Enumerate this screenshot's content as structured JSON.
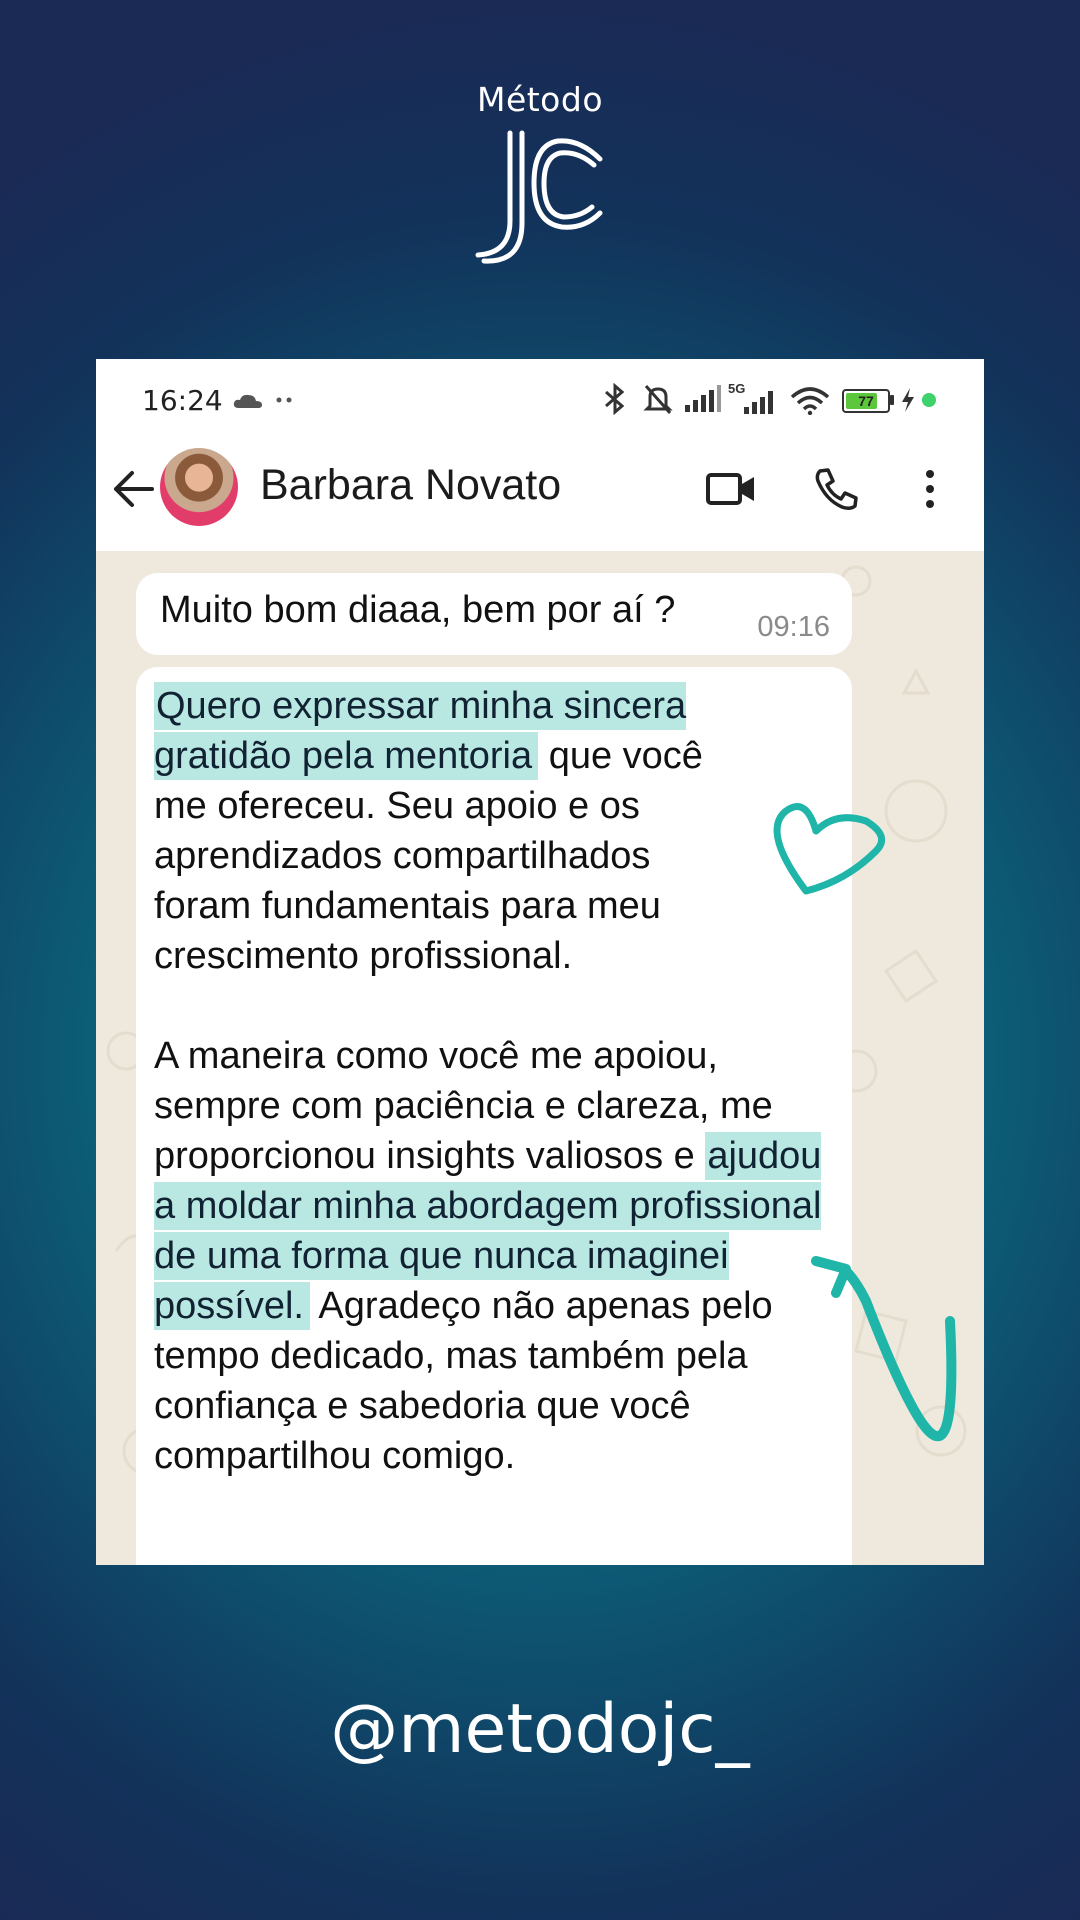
{
  "brand": {
    "word": "Método",
    "logo_letters": "JC"
  },
  "status_bar": {
    "time": "16:24",
    "network": "5G",
    "battery": "77"
  },
  "chat_header": {
    "contact_name": "Barbara Novato"
  },
  "messages": [
    {
      "text": "Muito bom diaaa, bem por aí ?",
      "time": "09:16"
    },
    {
      "p1_highlight": "Quero expressar minha sincera gratidão pela mentoria",
      "p1_rest": " que você me ofereceu. Seu apoio e os aprendizados compartilhados foram fundamentais para meu crescimento profissional.",
      "p2_start": "A maneira como você me apoiou, sempre com paciência e clareza, me proporcionou insights valiosos e ",
      "p2_highlight": "ajudou a moldar minha abordagem profissional de uma forma que nunca imaginei possível.",
      "p2_rest": " Agradeço não apenas pelo tempo dedicado, mas também pela confiança e sabedoria que você compartilhou comigo."
    }
  ],
  "footer": {
    "handle": "@metodojc_"
  },
  "colors": {
    "accent_teal": "#1fb5a9",
    "highlight": "#b9e8e3",
    "battery_green": "#5cc63c",
    "online_dot": "#3fd16a"
  }
}
